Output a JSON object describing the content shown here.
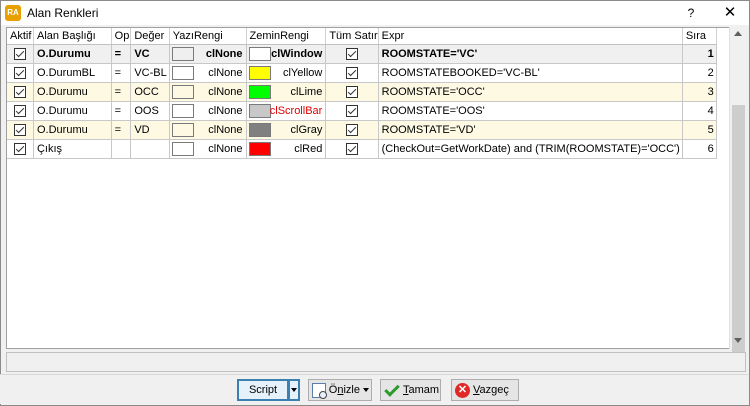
{
  "window": {
    "app_icon_text": "RA",
    "title": "Alan Renkleri",
    "help_glyph": "?",
    "close_glyph": "✕"
  },
  "grid": {
    "columns": [
      "Aktif",
      "Alan Başlığı",
      "Op",
      "Değer",
      "YazıRengi",
      "ZeminRengi",
      "Tüm Satır",
      "Expr",
      "Sıra"
    ],
    "rows": [
      {
        "aktif": true,
        "alan": "O.Durumu",
        "op": "=",
        "deger": "VC",
        "yazi_swatch": "#efefef",
        "yazi": "clNone",
        "zemin_swatch": "#ffffff",
        "zemin": "clWindow",
        "zemin_text_color": "#000000",
        "tum_satir": true,
        "expr": "ROOMSTATE='VC'",
        "sira": "1"
      },
      {
        "aktif": true,
        "alan": "O.DurumBL",
        "op": "=",
        "deger": "VC-BL",
        "yazi_swatch": "#ffffff",
        "yazi": "clNone",
        "zemin_swatch": "#ffff00",
        "zemin": "clYellow",
        "zemin_text_color": "#000000",
        "tum_satir": true,
        "expr": "ROOMSTATEBOOKED='VC-BL'",
        "sira": "2"
      },
      {
        "aktif": true,
        "alan": "O.Durumu",
        "op": "=",
        "deger": "OCC",
        "yazi_swatch": "#fdf9e3",
        "yazi": "clNone",
        "zemin_swatch": "#00ff00",
        "zemin": "clLime",
        "zemin_text_color": "#000000",
        "tum_satir": true,
        "expr": "ROOMSTATE='OCC'",
        "sira": "3"
      },
      {
        "aktif": true,
        "alan": "O.Durumu",
        "op": "=",
        "deger": "OOS",
        "yazi_swatch": "#ffffff",
        "yazi": "clNone",
        "zemin_swatch": "#c8c8c8",
        "zemin": "clScrollBar",
        "zemin_text_color": "#e00000",
        "tum_satir": true,
        "expr": "ROOMSTATE='OOS'",
        "sira": "4"
      },
      {
        "aktif": true,
        "alan": "O.Durumu",
        "op": "=",
        "deger": "VD",
        "yazi_swatch": "#fdf9e3",
        "yazi": "clNone",
        "zemin_swatch": "#808080",
        "zemin": "clGray",
        "zemin_text_color": "#000000",
        "tum_satir": true,
        "expr": "ROOMSTATE='VD'",
        "sira": "5"
      },
      {
        "aktif": true,
        "alan": "Çıkış",
        "op": "",
        "deger": "",
        "yazi_swatch": "#ffffff",
        "yazi": "clNone",
        "zemin_swatch": "#ff0000",
        "zemin": "clRed",
        "zemin_text_color": "#000000",
        "tum_satir": true,
        "expr": "(CheckOut=GetWorkDate) and (TRIM(ROOMSTATE)='OCC')",
        "sira": "6"
      }
    ]
  },
  "buttons": {
    "script": "Script",
    "preview_prefix": "Ö",
    "preview_underlined": "n",
    "preview_rest": "izle",
    "ok_underlined": "T",
    "ok_rest": "amam",
    "cancel_underlined": "V",
    "cancel_rest": "azgeç",
    "cancel_icon_glyph": "✕"
  }
}
